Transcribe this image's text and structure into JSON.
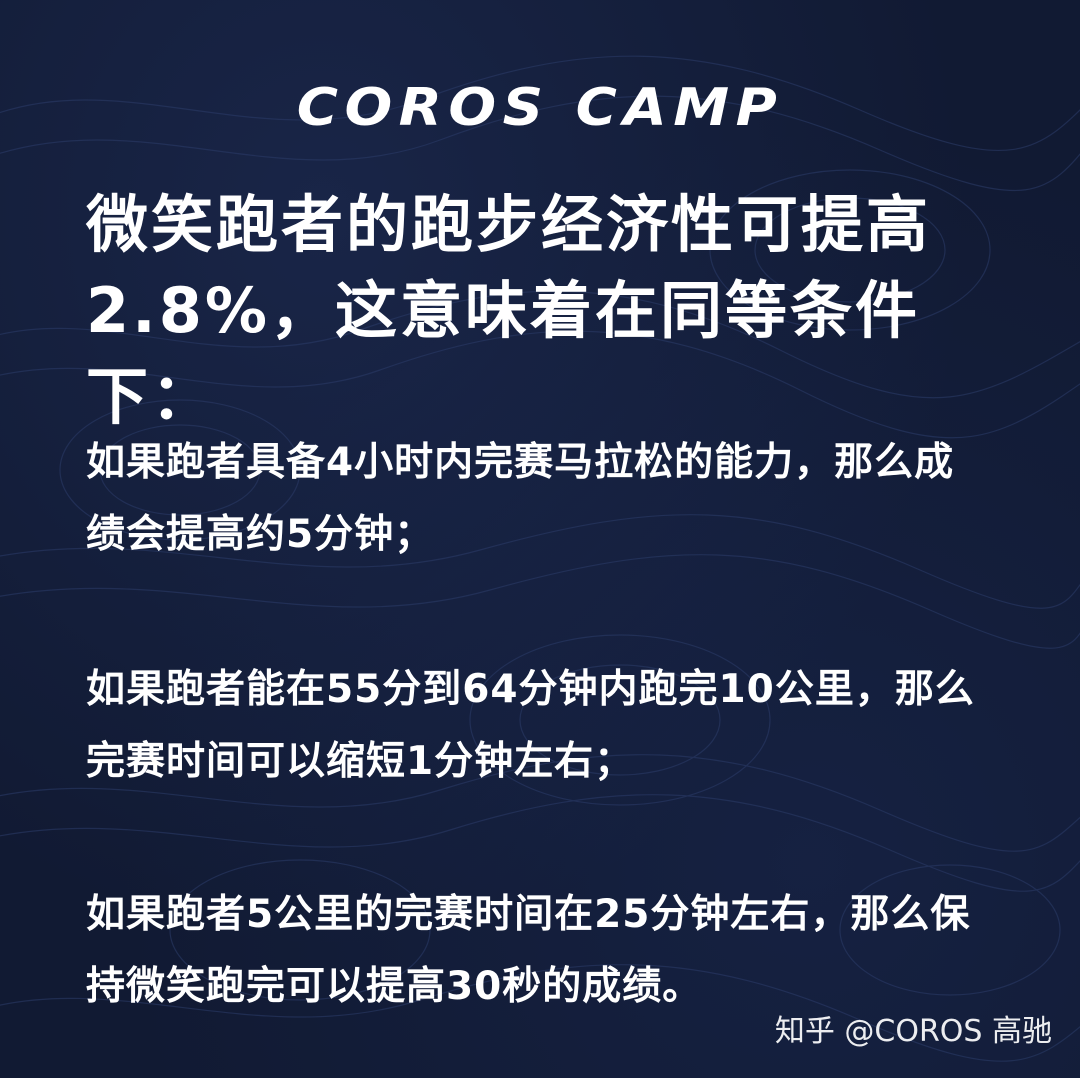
{
  "brand": {
    "logo_text": "COROS CAMP"
  },
  "headline": {
    "line1": "微笑跑者的跑步经济性可提高",
    "line2": "2.8%，这意味着在同等条件下："
  },
  "paragraphs": [
    {
      "line1": "如果跑者具备4小时内完赛马拉松的能力，那么成",
      "line2": "绩会提高约5分钟；"
    },
    {
      "line1": "如果跑者能在55分到64分钟内跑完10公里，那么",
      "line2": "完赛时间可以缩短1分钟左右；"
    },
    {
      "line1": "如果跑者5公里的完赛时间在25分钟左右，那么保",
      "line2": "持微笑跑完可以提高30秒的成绩。"
    }
  ],
  "watermark": {
    "text": "知乎 @COROS 高驰"
  },
  "colors": {
    "background": "#121b35",
    "text": "#ffffff",
    "contour_lines": "#2a3a66"
  }
}
